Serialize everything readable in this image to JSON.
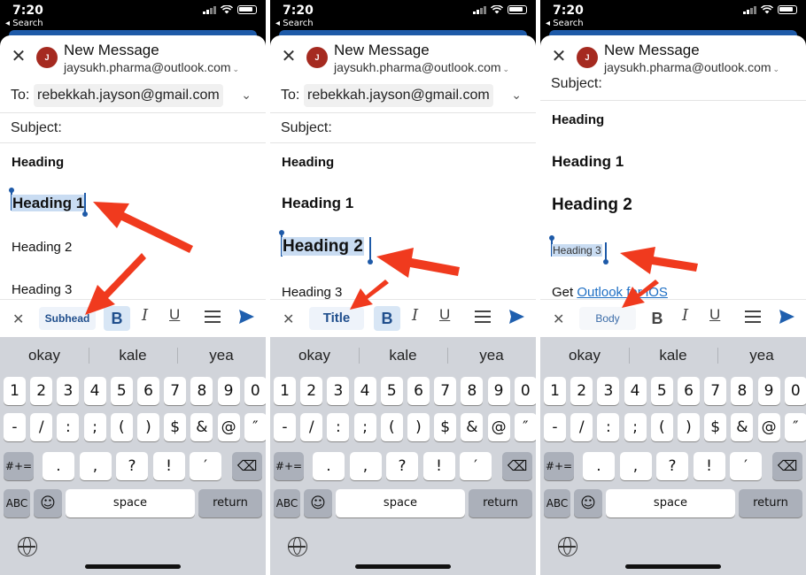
{
  "status": {
    "time": "7:20",
    "back_label": "Search"
  },
  "compose": {
    "title": "New Message",
    "from": "jaysukh.pharma@outlook.com",
    "avatar_initial": "J",
    "to_label": "To:",
    "to_value": "rebekkah.jayson@gmail.com",
    "subject_label": "Subject:"
  },
  "body_lines": {
    "heading": "Heading",
    "heading1": "Heading 1",
    "heading2": "Heading 2",
    "heading3": "Heading 3",
    "get": "Get",
    "link": "Outlook for iOS"
  },
  "toolbar": {
    "styles": [
      "Subhead",
      "Title",
      "Body"
    ],
    "bold": "B",
    "italic": "I",
    "underline": "U"
  },
  "keyboard": {
    "suggestions": [
      "okay",
      "kale",
      "yea"
    ],
    "row1": [
      "1",
      "2",
      "3",
      "4",
      "5",
      "6",
      "7",
      "8",
      "9",
      "0"
    ],
    "row2": [
      "-",
      "/",
      ":",
      ";",
      "(",
      ")",
      "$",
      "&",
      "@",
      "″"
    ],
    "row3_left": "#+=",
    "row3": [
      ".",
      ",",
      "?",
      "!",
      "′"
    ],
    "abc": "ABC",
    "space": "space",
    "return": "return"
  },
  "colors": {
    "accent": "#1f4e8c",
    "selection": "#c9dcf2",
    "avatar": "#a52a20",
    "arrow": "#f03a1e"
  }
}
